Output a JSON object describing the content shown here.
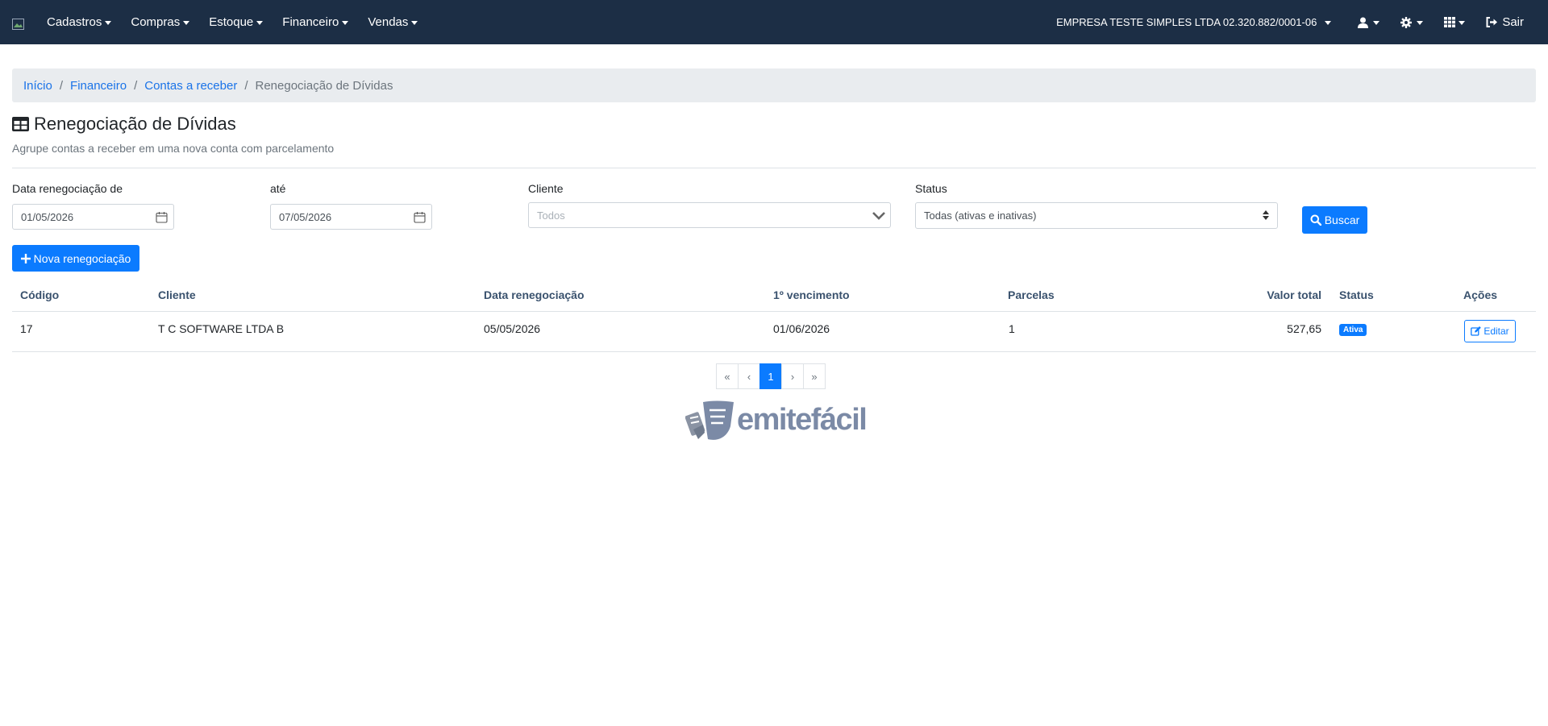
{
  "navbar": {
    "menu": [
      {
        "label": "Cadastros"
      },
      {
        "label": "Compras"
      },
      {
        "label": "Estoque"
      },
      {
        "label": "Financeiro"
      },
      {
        "label": "Vendas"
      }
    ],
    "company": "EMPRESA TESTE SIMPLES LTDA 02.320.882/0001-06",
    "logout_label": "Sair"
  },
  "breadcrumb": {
    "items": [
      "Início",
      "Financeiro",
      "Contas a receber"
    ],
    "current": "Renegociação de Dívidas"
  },
  "page": {
    "title": "Renegociação de Dívidas",
    "subtitle": "Agrupe contas a receber em uma nova conta com parcelamento"
  },
  "filters": {
    "date_from_label": "Data renegociação de",
    "date_from_value": "01/05/2026",
    "date_to_label": "até",
    "date_to_value": "07/05/2026",
    "client_label": "Cliente",
    "client_placeholder": "Todos",
    "status_label": "Status",
    "status_value": "Todas (ativas e inativas)",
    "search_label": "Buscar"
  },
  "new_button_label": "Nova renegociação",
  "table": {
    "headers": {
      "code": "Código",
      "client": "Cliente",
      "date": "Data renegociação",
      "first_due": "1º vencimento",
      "installments": "Parcelas",
      "total": "Valor total",
      "status": "Status",
      "actions": "Ações"
    },
    "rows": [
      {
        "code": "17",
        "client": "T C SOFTWARE LTDA B",
        "date": "05/05/2026",
        "first_due": "01/06/2026",
        "installments": "1",
        "total": "527,65",
        "status": "Ativa",
        "edit_label": "Editar"
      }
    ]
  },
  "pagination": {
    "first": "«",
    "prev": "‹",
    "current": "1",
    "next": "›",
    "last": "»"
  },
  "brand": {
    "name": "emitefácil"
  },
  "colors": {
    "navbar": "#1c2e45",
    "primary": "#0b7bff",
    "link": "#1a73e8"
  }
}
